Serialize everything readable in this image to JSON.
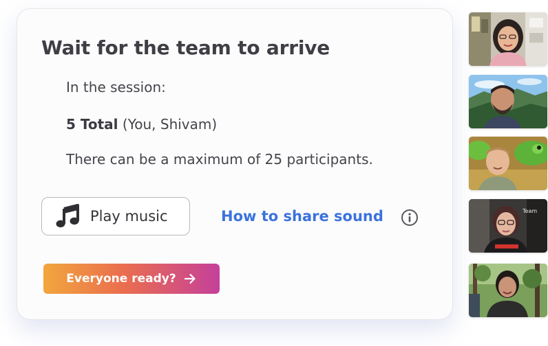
{
  "panel": {
    "title": "Wait for the team to arrive",
    "session_label": "In the session:",
    "total_count": "5 Total",
    "participants_names": "(You, Shivam)",
    "max_note": "There can be a maximum of 25 participants."
  },
  "actions": {
    "play_music_label": "Play music",
    "play_music_icon": "music-note-icon",
    "share_sound_link": "How to share sound",
    "info_icon": "info-icon",
    "ready_button_label": "Everyone ready?",
    "ready_button_icon": "arrow-right-icon"
  },
  "colors": {
    "link": "#3b72dc",
    "ready_gradient_start": "#f2a63e",
    "ready_gradient_end": "#c5409b",
    "title_text": "#3e3e44"
  },
  "participant_tiles": {
    "count": 5,
    "tile_5_overlay_text": "Team"
  }
}
